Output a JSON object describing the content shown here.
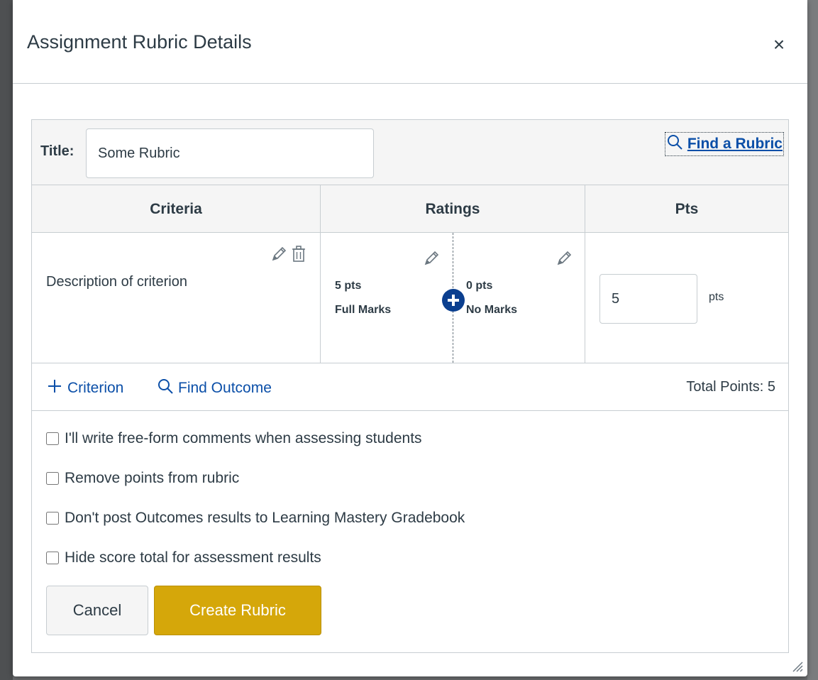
{
  "modal": {
    "title": "Assignment Rubric Details",
    "close_label": "×"
  },
  "rubric": {
    "title_label": "Title:",
    "title_value": "Some Rubric",
    "find_rubric_label": "Find a Rubric",
    "columns": {
      "criteria": "Criteria",
      "ratings": "Ratings",
      "pts": "Pts"
    },
    "criteria": [
      {
        "description": "Description of criterion",
        "ratings": [
          {
            "points": "5 pts",
            "description": "Full Marks"
          },
          {
            "points": "0 pts",
            "description": "No Marks"
          }
        ],
        "points_value": "5",
        "points_suffix": "pts"
      }
    ],
    "add_criterion_label": "Criterion",
    "find_outcome_label": "Find Outcome",
    "total_points": "Total Points: 5"
  },
  "options": [
    {
      "label": "I'll write free-form comments when assessing students",
      "checked": false
    },
    {
      "label": "Remove points from rubric",
      "checked": false
    },
    {
      "label": "Don't post Outcomes results to Learning Mastery Gradebook",
      "checked": false
    },
    {
      "label": "Hide score total for assessment results",
      "checked": false
    }
  ],
  "actions": {
    "cancel_label": "Cancel",
    "create_label": "Create Rubric"
  },
  "colors": {
    "primary": "#d5a70a",
    "link": "#0b4fa8",
    "add_rating": "#0b3f8f",
    "text": "#2d3b45",
    "border": "#c7cdd1"
  }
}
